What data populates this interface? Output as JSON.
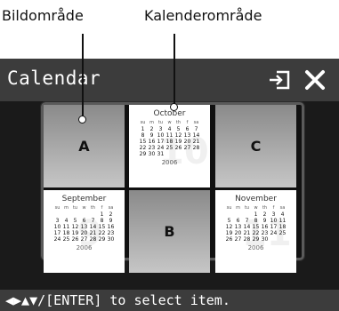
{
  "callouts": {
    "bildomrade": "Bildområde",
    "kalenderomrade": "Kalenderområde"
  },
  "titlebar": {
    "title": "Calendar"
  },
  "photos": {
    "a": "A",
    "b": "B",
    "c": "C"
  },
  "calendars": {
    "october": {
      "month": "October",
      "year": "2006",
      "watermark": "10",
      "weekdays": [
        "su",
        "m",
        "tu",
        "w",
        "th",
        "f",
        "sa"
      ],
      "days": [
        "1",
        "2",
        "3",
        "4",
        "5",
        "6",
        "7",
        "8",
        "9",
        "10",
        "11",
        "12",
        "13",
        "14",
        "15",
        "16",
        "17",
        "18",
        "19",
        "20",
        "21",
        "22",
        "23",
        "24",
        "25",
        "26",
        "27",
        "28",
        "29",
        "30",
        "31"
      ],
      "offset": 0
    },
    "september": {
      "month": "September",
      "year": "2006",
      "watermark": "9",
      "weekdays": [
        "su",
        "m",
        "tu",
        "w",
        "th",
        "f",
        "sa"
      ],
      "days": [
        "1",
        "2",
        "3",
        "4",
        "5",
        "6",
        "7",
        "8",
        "9",
        "10",
        "11",
        "12",
        "13",
        "14",
        "15",
        "16",
        "17",
        "18",
        "19",
        "20",
        "21",
        "22",
        "23",
        "24",
        "25",
        "26",
        "27",
        "28",
        "29",
        "30"
      ],
      "offset": 5
    },
    "november": {
      "month": "November",
      "year": "2006",
      "watermark": "11",
      "weekdays": [
        "su",
        "m",
        "tu",
        "w",
        "th",
        "f",
        "sa"
      ],
      "days": [
        "1",
        "2",
        "3",
        "4",
        "5",
        "6",
        "7",
        "8",
        "9",
        "10",
        "11",
        "12",
        "13",
        "14",
        "15",
        "16",
        "17",
        "18",
        "19",
        "20",
        "21",
        "22",
        "23",
        "24",
        "25",
        "26",
        "27",
        "28",
        "29",
        "30"
      ],
      "offset": 3
    }
  },
  "status": {
    "hint": "◀▶▲▼/[ENTER] to select item."
  },
  "colors": {
    "bar": "#3c3c3c",
    "screen": "#1a1a1a",
    "accent": "#ffffff"
  },
  "icons": {
    "return": "return-icon",
    "close": "close-icon"
  }
}
